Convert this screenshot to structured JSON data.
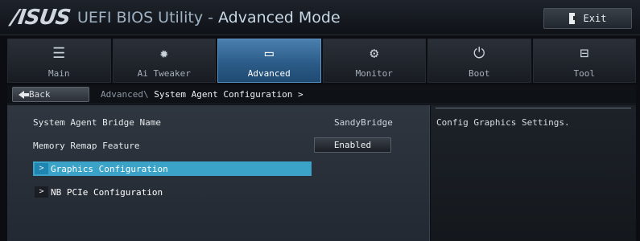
{
  "window": {
    "logo_text": "/ISUS",
    "title_prefix": "UEFI BIOS Utility - ",
    "title_mode": "Advanced Mode",
    "exit_label": "Exit"
  },
  "tabs": [
    {
      "label": "Main",
      "icon": "list-icon",
      "glyph": "☰",
      "active": false
    },
    {
      "label": "Ai Tweaker",
      "icon": "tweaker-icon",
      "glyph": "✹",
      "active": false
    },
    {
      "label": "Advanced",
      "icon": "advanced-icon",
      "glyph": "▭",
      "active": true
    },
    {
      "label": "Monitor",
      "icon": "monitor-icon",
      "glyph": "⚙",
      "active": false
    },
    {
      "label": "Boot",
      "icon": "power-icon",
      "glyph": "⏻",
      "active": false
    },
    {
      "label": "Tool",
      "icon": "tool-icon",
      "glyph": "⊟",
      "active": false
    }
  ],
  "breadcrumb": {
    "back_label": "Back",
    "path": "Advanced\\ ",
    "current": "System Agent Configuration >"
  },
  "settings": {
    "bridge_label": "System Agent Bridge Name",
    "bridge_value": "SandyBridge",
    "remap_label": "Memory Remap Feature",
    "remap_value": "Enabled",
    "graphics_label": "Graphics Configuration",
    "nbpcie_label": "NB PCIe Configuration",
    "submenu_glyph": ">"
  },
  "help": {
    "text": "Config Graphics Settings."
  },
  "colors": {
    "accent": "#3aa3c7",
    "active_tab": "#2a5a86"
  }
}
